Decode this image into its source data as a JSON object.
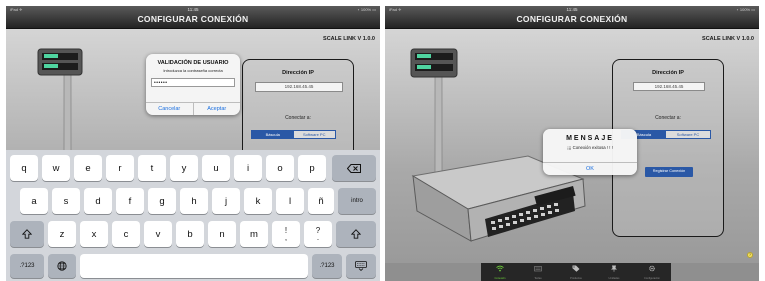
{
  "screen_a": {
    "status_left": "iPad ✈",
    "status_time": "11:45",
    "status_right": "⋆ 100% ▭",
    "title": "CONFIGURAR CONEXIÓN",
    "version": "SCALE LINK V 1.0.0",
    "panel_title": "Dirección IP",
    "ip_value": "192.168.45.45",
    "connect_label": "Conectar a:",
    "seg_bascula": "Báscula",
    "seg_software": "Software PC",
    "dialog": {
      "title": "VALIDACIÓN DE USUARIO",
      "message": "Introduzca la contraseña correcta",
      "password": "••••••",
      "cancel": "Cancelar",
      "accept": "Aceptar"
    },
    "keyboard": {
      "row1": [
        "q",
        "w",
        "e",
        "r",
        "t",
        "y",
        "u",
        "i",
        "o",
        "p"
      ],
      "row2": [
        "a",
        "s",
        "d",
        "f",
        "g",
        "h",
        "j",
        "k",
        "l",
        "ñ"
      ],
      "row3": [
        "z",
        "x",
        "c",
        "v",
        "b",
        "n",
        "m"
      ],
      "excl_top": "!",
      "excl_bot": ",",
      "quest_top": "?",
      "quest_bot": ".",
      "intro": "intro",
      "numbers": ".?123"
    }
  },
  "screen_b": {
    "status_left": "iPad ✈",
    "status_time": "11:45",
    "status_right": "⋆ 100% ▭",
    "title": "CONFIGURAR CONEXIÓN",
    "version": "SCALE LINK V 1.0.0",
    "panel_title": "Dirección IP",
    "ip_value": "192.168.45.45",
    "connect_label": "Conectar a:",
    "seg_bascula": "Báscula",
    "seg_software": "Software PC",
    "register_button": "Registrar Conexión",
    "dialog": {
      "title": "MENSAJE",
      "message": "¡¡¡ Conexión exitosa ! ! !",
      "ok": "OK"
    },
    "tabs": [
      {
        "label": "Conexión",
        "icon": "wifi-icon"
      },
      {
        "label": "Teclas",
        "icon": "keyboard-icon"
      },
      {
        "label": "Productos",
        "icon": "tag-icon"
      },
      {
        "label": "Unidades",
        "icon": "pin-icon"
      },
      {
        "label": "Configuración",
        "icon": "gear-icon"
      }
    ],
    "colors": {
      "accent": "#2a58a6",
      "tab_active": "#6fd43a",
      "link": "#1a6fe0"
    }
  }
}
